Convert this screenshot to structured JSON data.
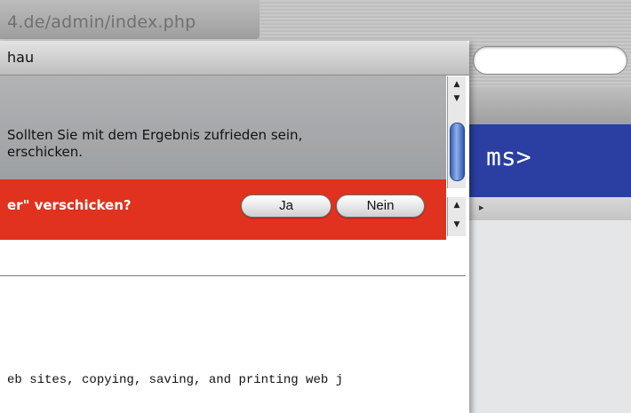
{
  "browser": {
    "url_text": "4.de/admin/index.php",
    "banner_text": "ms>"
  },
  "dialog": {
    "title": "hau",
    "message_line1": "Sollten Sie mit dem Ergebnis zufrieden sein,",
    "message_line2": "erschicken.",
    "question": "er\" verschicken?",
    "yes_label": "Ja",
    "no_label": "Nein",
    "preview_text": "eb sites, copying, saving, and printing web j"
  },
  "colors": {
    "alert_red": "#e0321e",
    "banner_blue": "#2a3fa1",
    "scroll_thumb": "#3a5fb6"
  },
  "icons": {
    "scroll_up": "triangle-up",
    "scroll_down": "triangle-down",
    "tab_arrow": "triangle-right"
  }
}
